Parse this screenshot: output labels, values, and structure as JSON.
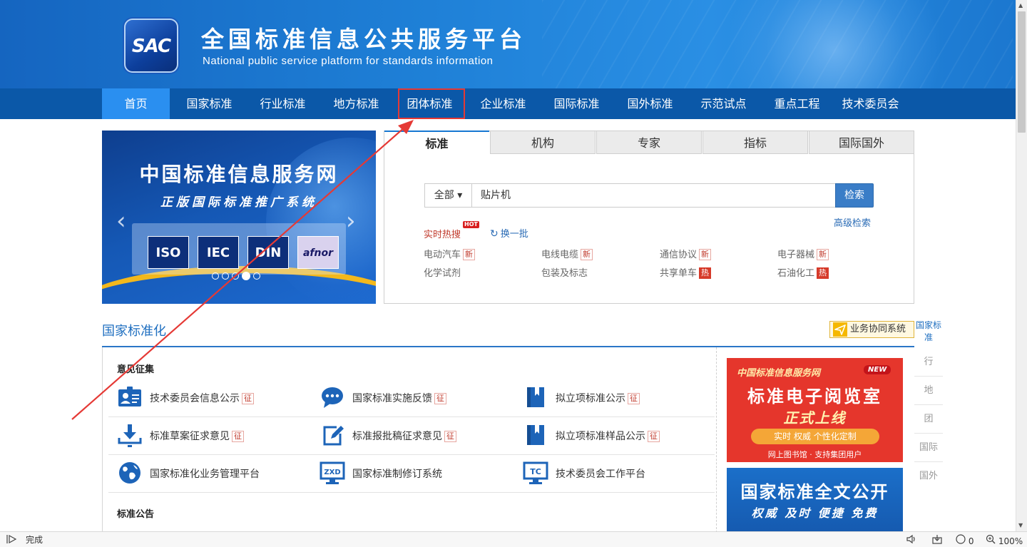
{
  "header": {
    "logo_text": "SAC",
    "title": "全国标准信息公共服务平台",
    "subtitle": "National public service platform  for standards information"
  },
  "nav": {
    "items": [
      {
        "label": "首页"
      },
      {
        "label": "国家标准"
      },
      {
        "label": "行业标准"
      },
      {
        "label": "地方标准"
      },
      {
        "label": "团体标准"
      },
      {
        "label": "企业标准"
      },
      {
        "label": "国际标准"
      },
      {
        "label": "国外标准"
      },
      {
        "label": "示范试点"
      },
      {
        "label": "重点工程"
      },
      {
        "label": "技术委员会"
      }
    ],
    "active": "首页",
    "highlighted": "团体标准"
  },
  "banner": {
    "title": "中国标准信息服务网",
    "subtitle": "正版国际标准推广系统",
    "orgs": [
      "ISO",
      "IEC",
      "DIN",
      "afnor"
    ],
    "prev_arrow": "‹",
    "next_arrow": "›"
  },
  "search": {
    "tabs": [
      "标准",
      "机构",
      "专家",
      "指标",
      "国际国外"
    ],
    "scope": "全部",
    "scope_caret": "▾",
    "query": "贴片机",
    "button": "检索",
    "advanced": "高级检索",
    "hot_label": "实时热搜",
    "hot_badge": "HOT",
    "refresh": "换一批",
    "refresh_icon": "↻",
    "hot_items": [
      {
        "text": "电动汽车",
        "tag": "新"
      },
      {
        "text": "电线电缆",
        "tag": "新"
      },
      {
        "text": "通信协议",
        "tag": "新"
      },
      {
        "text": "电子器械",
        "tag": "新"
      },
      {
        "text": "化学试剂",
        "tag": ""
      },
      {
        "text": "包装及标志",
        "tag": ""
      },
      {
        "text": "共享单车",
        "tag": "热"
      },
      {
        "text": "石油化工",
        "tag": "热"
      }
    ]
  },
  "section": {
    "title": "国家标准化",
    "collab_label": "业务协同系统",
    "side_nav": [
      "国家标准",
      "行",
      "地",
      "团",
      "国际",
      "国外"
    ],
    "group1": "意见征集",
    "group2": "标准公告",
    "entries": [
      {
        "text": "技术委员会信息公示",
        "tag": "征",
        "icon": "id-card-icon"
      },
      {
        "text": "国家标准实施反馈",
        "tag": "征",
        "icon": "chat-bubble-icon"
      },
      {
        "text": "拟立项标准公示",
        "tag": "征",
        "icon": "book-icon"
      },
      {
        "text": "标准草案征求意见",
        "tag": "征",
        "icon": "download-monitor-icon"
      },
      {
        "text": "标准报批稿征求意见",
        "tag": "征",
        "icon": "edit-icon"
      },
      {
        "text": "拟立项标准样品公示",
        "tag": "征",
        "icon": "book-icon"
      },
      {
        "text": "国家标准化业务管理平台",
        "tag": "",
        "icon": "globe-icon"
      },
      {
        "text": "国家标准制修订系统",
        "tag": "",
        "icon": "zxd-monitor-icon"
      },
      {
        "text": "技术委员会工作平台",
        "tag": "",
        "icon": "tc-monitor-icon"
      }
    ],
    "zxd_label": "ZXD",
    "tc_label": "TC"
  },
  "ads": {
    "reading_room": {
      "top": "中国标准信息服务网",
      "badge": "NEW",
      "title": "标准电子阅览室",
      "slogan": "正式上线",
      "pill": "实时  权威  个性化定制",
      "footer": "网上图书馆 · 支持集团用户"
    },
    "full_text": {
      "title": "国家标准全文公开",
      "slogan": "权威  及时  便捷  免费"
    }
  },
  "status_bar": {
    "status_text": "完成",
    "counter": "0",
    "zoom": "100%"
  },
  "colors": {
    "nav_bg": "#0b58a8",
    "nav_active": "#2a8ff0",
    "accent_blue": "#1f6fc0",
    "annotation_red": "#e53935"
  }
}
